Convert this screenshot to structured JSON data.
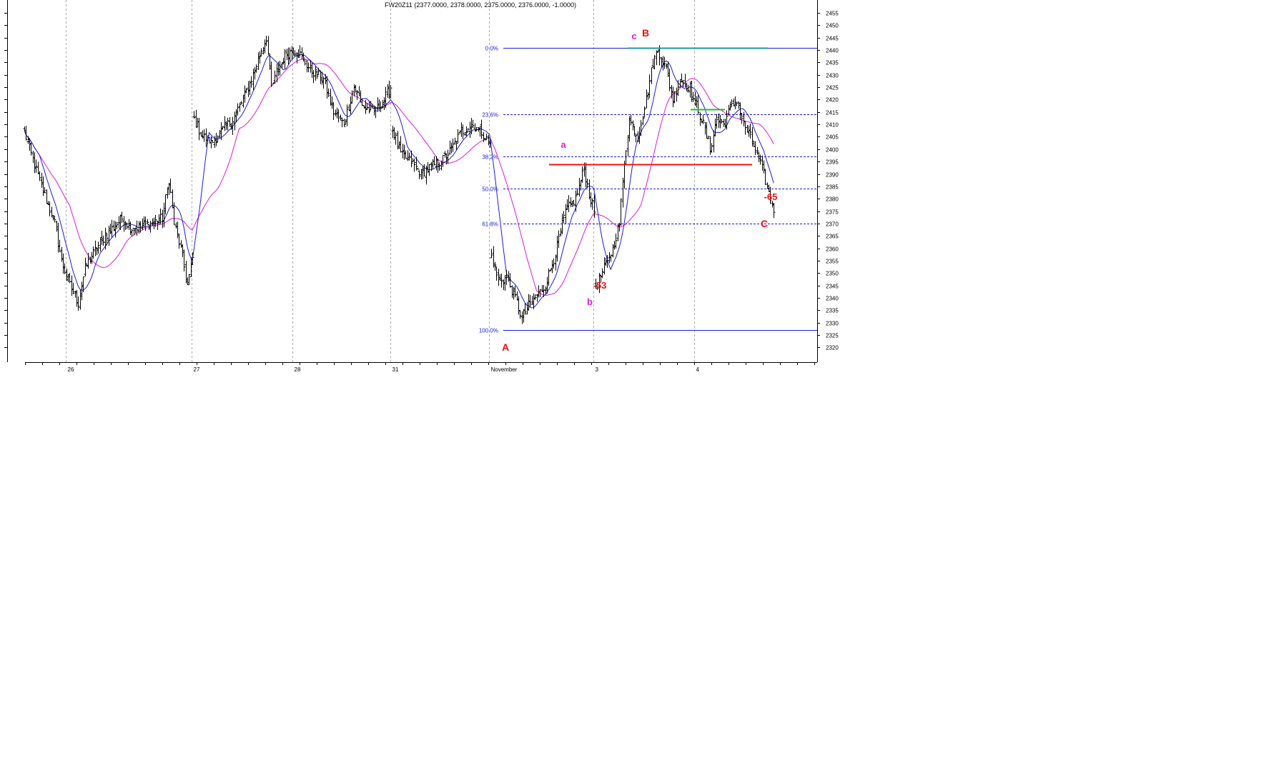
{
  "chart_data": {
    "type": "candlestick",
    "title": "FW20Z11 (2377.0000, 2378.0000, 2375.0000, 2376.0000, -1.0000)",
    "ylim": [
      2315,
      2460
    ],
    "y_ticks": [
      2320,
      2325,
      2330,
      2335,
      2340,
      2345,
      2350,
      2355,
      2360,
      2365,
      2370,
      2375,
      2380,
      2385,
      2390,
      2395,
      2400,
      2405,
      2410,
      2415,
      2420,
      2425,
      2430,
      2435,
      2440,
      2445,
      2450,
      2455
    ],
    "x_tick_labels": [
      "26",
      "27",
      "28",
      "31",
      "November",
      "3",
      "4"
    ],
    "grid": "vertical dashed at day separators",
    "colors": {
      "price": "#000000",
      "ma_fast": "#1c1cdc",
      "ma_slow": "#e01ad6",
      "fib_lines": "#1a1adf",
      "resistance": "#ee1111",
      "top_line": "#1a9a9a",
      "green_marker": "#22bb22",
      "annotation_red": "#ee1111",
      "annotation_magenta": "#e01ad6"
    },
    "anchors": [
      {
        "x": 0,
        "y": 2407
      },
      {
        "x": 4,
        "y": 2398
      },
      {
        "x": 10,
        "y": 2385
      },
      {
        "x": 18,
        "y": 2370
      },
      {
        "x": 22,
        "y": 2355
      },
      {
        "x": 27,
        "y": 2345
      },
      {
        "x": 32,
        "y": 2338
      },
      {
        "x": 36,
        "y": 2352
      },
      {
        "x": 40,
        "y": 2357
      },
      {
        "x": 48,
        "y": 2365
      },
      {
        "x": 58,
        "y": 2372
      },
      {
        "x": 64,
        "y": 2368
      },
      {
        "x": 75,
        "y": 2370
      },
      {
        "x": 82,
        "y": 2372
      },
      {
        "x": 86,
        "y": 2388
      },
      {
        "x": 89,
        "y": 2370
      },
      {
        "x": 93,
        "y": 2360
      },
      {
        "x": 97,
        "y": 2345
      },
      {
        "x": 100,
        "y": 2356
      },
      {
        "x": 101,
        "y": 2412
      },
      {
        "x": 106,
        "y": 2405
      },
      {
        "x": 112,
        "y": 2403
      },
      {
        "x": 118,
        "y": 2408
      },
      {
        "x": 124,
        "y": 2412
      },
      {
        "x": 130,
        "y": 2420
      },
      {
        "x": 136,
        "y": 2430
      },
      {
        "x": 141,
        "y": 2440
      },
      {
        "x": 144,
        "y": 2445
      },
      {
        "x": 147,
        "y": 2425
      },
      {
        "x": 151,
        "y": 2432
      },
      {
        "x": 155,
        "y": 2438
      },
      {
        "x": 160,
        "y": 2440
      },
      {
        "x": 164,
        "y": 2438
      },
      {
        "x": 170,
        "y": 2432
      },
      {
        "x": 178,
        "y": 2428
      },
      {
        "x": 184,
        "y": 2415
      },
      {
        "x": 190,
        "y": 2410
      },
      {
        "x": 196,
        "y": 2425
      },
      {
        "x": 202,
        "y": 2417
      },
      {
        "x": 208,
        "y": 2415
      },
      {
        "x": 214,
        "y": 2420
      },
      {
        "x": 218,
        "y": 2425
      },
      {
        "x": 219,
        "y": 2408
      },
      {
        "x": 224,
        "y": 2398
      },
      {
        "x": 230,
        "y": 2395
      },
      {
        "x": 236,
        "y": 2390
      },
      {
        "x": 242,
        "y": 2393
      },
      {
        "x": 248,
        "y": 2395
      },
      {
        "x": 254,
        "y": 2400
      },
      {
        "x": 260,
        "y": 2407
      },
      {
        "x": 266,
        "y": 2410
      },
      {
        "x": 272,
        "y": 2407
      },
      {
        "x": 277,
        "y": 2402
      },
      {
        "x": 278,
        "y": 2357
      },
      {
        "x": 282,
        "y": 2347
      },
      {
        "x": 287,
        "y": 2348
      },
      {
        "x": 292,
        "y": 2340
      },
      {
        "x": 296,
        "y": 2332
      },
      {
        "x": 299,
        "y": 2336
      },
      {
        "x": 304,
        "y": 2340
      },
      {
        "x": 310,
        "y": 2345
      },
      {
        "x": 316,
        "y": 2358
      },
      {
        "x": 322,
        "y": 2375
      },
      {
        "x": 328,
        "y": 2380
      },
      {
        "x": 333,
        "y": 2392
      },
      {
        "x": 336,
        "y": 2382
      },
      {
        "x": 339,
        "y": 2375
      },
      {
        "x": 340,
        "y": 2345
      },
      {
        "x": 344,
        "y": 2350
      },
      {
        "x": 350,
        "y": 2360
      },
      {
        "x": 354,
        "y": 2370
      },
      {
        "x": 357,
        "y": 2395
      },
      {
        "x": 360,
        "y": 2412
      },
      {
        "x": 365,
        "y": 2405
      },
      {
        "x": 370,
        "y": 2420
      },
      {
        "x": 374,
        "y": 2435
      },
      {
        "x": 377,
        "y": 2440
      },
      {
        "x": 382,
        "y": 2432
      },
      {
        "x": 386,
        "y": 2420
      },
      {
        "x": 390,
        "y": 2428
      },
      {
        "x": 396,
        "y": 2425
      },
      {
        "x": 399,
        "y": 2418
      },
      {
        "x": 400,
        "y": 2418
      },
      {
        "x": 404,
        "y": 2410
      },
      {
        "x": 408,
        "y": 2400
      },
      {
        "x": 412,
        "y": 2412
      },
      {
        "x": 416,
        "y": 2410
      },
      {
        "x": 420,
        "y": 2416
      },
      {
        "x": 424,
        "y": 2420
      },
      {
        "x": 428,
        "y": 2410
      },
      {
        "x": 432,
        "y": 2405
      },
      {
        "x": 436,
        "y": 2398
      },
      {
        "x": 440,
        "y": 2390
      },
      {
        "x": 443,
        "y": 2382
      },
      {
        "x": 446,
        "y": 2376
      }
    ],
    "day_starts": [
      26,
      101,
      161,
      219,
      278,
      340,
      400
    ],
    "fibonacci": [
      {
        "label": "0.0%",
        "value": 2441
      },
      {
        "label": "23.6%",
        "value": 2414
      },
      {
        "label": "38.2%",
        "value": 2397
      },
      {
        "label": "50.0%",
        "value": 2384
      },
      {
        "label": "61.8%",
        "value": 2370
      },
      {
        "label": "100.0%",
        "value": 2327
      }
    ],
    "resistance_level": 2394,
    "annotations": {
      "A": "A",
      "B": "B",
      "C": "C",
      "a": "a",
      "b": "b",
      "c": "c",
      "minus65": "-65",
      "minus53": "-53"
    }
  }
}
